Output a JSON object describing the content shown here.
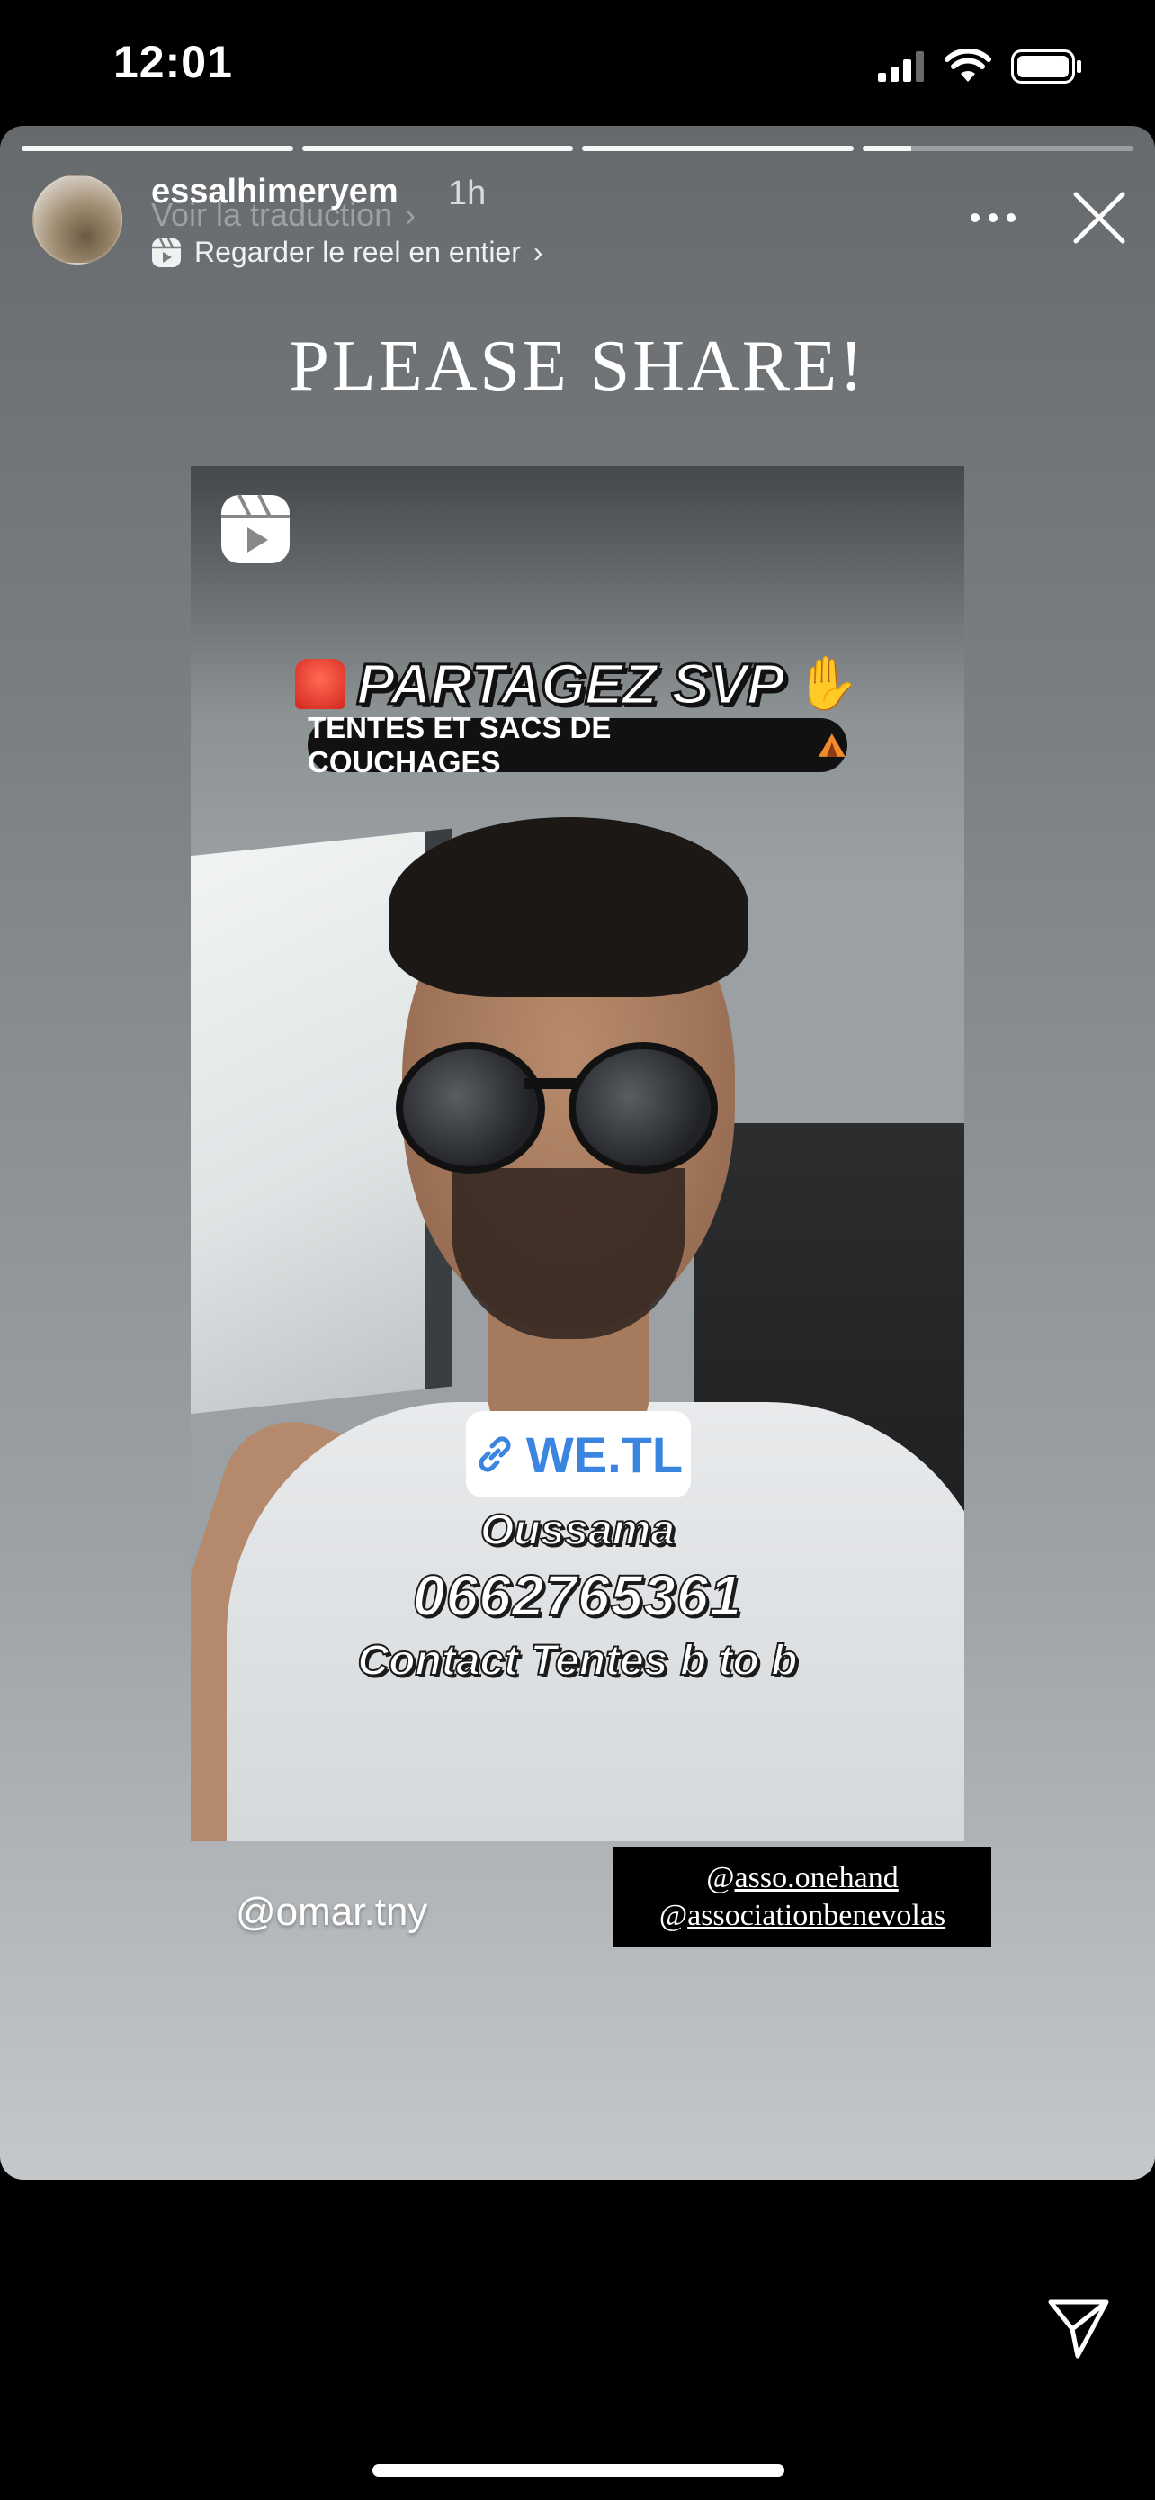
{
  "status_bar": {
    "time": "12:01"
  },
  "story": {
    "progress_segments": [
      1.0,
      1.0,
      1.0,
      0.18
    ],
    "author": {
      "username": "essalhimeryem",
      "time_ago": "1h"
    },
    "translate_link": "Voir la traduction",
    "reel_link": "Regarder le reel en entier",
    "title": "PLEASE SHARE!",
    "reel": {
      "headline": "PARTAGEZ SVP",
      "pill_text": "TENTES ET SACS DE COUCHAGES",
      "link_label": "WE.TL",
      "name": "Oussama",
      "phone": "0662765361",
      "contact": "Contact Tentes b to b"
    },
    "mention_left": "@omar.tny",
    "mentions": [
      "@asso.onehand",
      "@associationbenevolas"
    ]
  },
  "icons": {
    "signal": "signal-icon",
    "wifi": "wifi-icon",
    "battery": "battery-icon",
    "more": "more-icon",
    "close": "close-icon",
    "reel": "reel-icon",
    "send": "send-icon"
  }
}
